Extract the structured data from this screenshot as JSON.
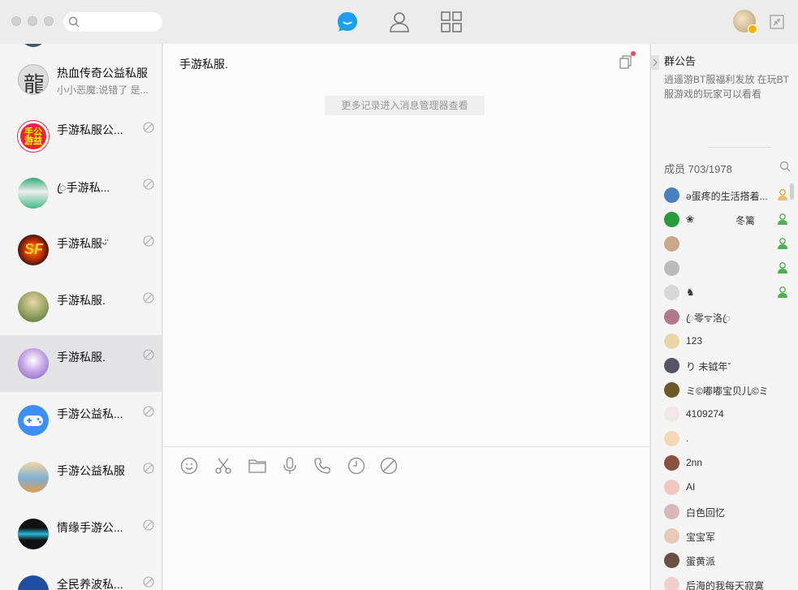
{
  "titlebar": {
    "search_placeholder": "",
    "icons": [
      "chat-bubble-icon",
      "contacts-icon",
      "apps-grid-icon"
    ],
    "accent": "#1aa0f0"
  },
  "sidebar": {
    "items": [
      {
        "name": "热血传奇公益私服",
        "sub": "小小恶魔:说错了  是...",
        "muted": false,
        "active": false
      },
      {
        "name": "手游私服公...",
        "sub": "",
        "muted": true,
        "active": false
      },
      {
        "name": "ꦿ手游私...",
        "sub": "",
        "muted": true,
        "active": false
      },
      {
        "name": "手游私服ᵕ̈",
        "sub": "",
        "muted": true,
        "active": false
      },
      {
        "name": "手游私服.",
        "sub": "",
        "muted": true,
        "active": false
      },
      {
        "name": "手游私服.",
        "sub": "",
        "muted": true,
        "active": true
      },
      {
        "name": "手游公益私...",
        "sub": "",
        "muted": true,
        "active": false
      },
      {
        "name": "手游公益私服",
        "sub": "",
        "muted": true,
        "active": false
      },
      {
        "name": "情缘手游公...",
        "sub": "",
        "muted": true,
        "active": false
      },
      {
        "name": "全民养波私...",
        "sub": "",
        "muted": true,
        "active": false
      }
    ]
  },
  "chat": {
    "title": "手游私服.",
    "history_notice": "更多记录进入消息管理器查看",
    "tools": [
      "emoji-icon",
      "scissors-icon",
      "folder-icon",
      "microphone-icon",
      "phone-icon",
      "clock-icon",
      "block-icon"
    ]
  },
  "panel": {
    "announcement_title": "群公告",
    "announcement_body": "逍遥游BT服福利发放    在玩BT服游戏的玩家可以看看",
    "members_label": "成员 703/1978",
    "members": [
      {
        "name": "ə蛋疼的生活搭着...",
        "extra": "",
        "admin": true
      },
      {
        "name": "❀",
        "extra": "冬篱",
        "admin": true
      },
      {
        "name": "",
        "extra": "",
        "admin": true
      },
      {
        "name": "",
        "extra": "",
        "admin": true
      },
      {
        "name": "♞",
        "extra": "",
        "admin": true
      },
      {
        "name": "ꦿ零ᯤ洛ꦿ",
        "extra": "",
        "admin": false
      },
      {
        "name": "123",
        "extra": "",
        "admin": false
      },
      {
        "name": "り 未钺年ˇ",
        "extra": "",
        "admin": false
      },
      {
        "name": "ミ©嘟嘟宝贝儿©ミ",
        "extra": "",
        "admin": false
      },
      {
        "name": "4109274",
        "extra": "",
        "admin": false
      },
      {
        "name": ".",
        "extra": "",
        "admin": false
      },
      {
        "name": "2nn",
        "extra": "",
        "admin": false
      },
      {
        "name": "AI",
        "extra": "",
        "admin": false
      },
      {
        "name": "白色回忆",
        "extra": "",
        "admin": false
      },
      {
        "name": "宝宝军",
        "extra": "",
        "admin": false
      },
      {
        "name": "蛋黄派",
        "extra": "",
        "admin": false
      },
      {
        "name": "后海的我每天寂寞",
        "extra": "",
        "admin": false
      }
    ]
  }
}
